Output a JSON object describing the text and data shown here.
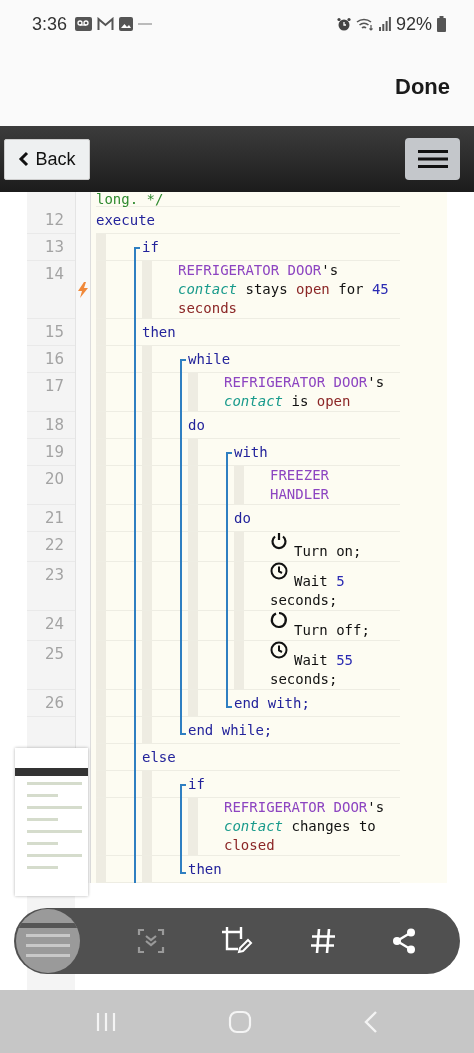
{
  "status_bar": {
    "time": "3:36",
    "battery": "92%"
  },
  "header": {
    "done": "Done"
  },
  "app_bar": {
    "back": "Back"
  },
  "code": [
    {
      "kind": "line",
      "flagged": false,
      "words": [
        [
          {
            "text": "long. */",
            "kind": "comment"
          }
        ]
      ]
    },
    {
      "kind": "line",
      "num": "12",
      "flagged": false,
      "words": [
        [
          {
            "text": "execute",
            "kind": "keyword"
          }
        ]
      ],
      "children": [
        {
          "kind": "block",
          "parts": [
            {
              "kind": "line",
              "num": "13",
              "flagged": false,
              "words": [
                [
                  {
                    "text": "if",
                    "kind": "keyword"
                  }
                ]
              ],
              "children": [
                {
                  "kind": "line",
                  "num": "14",
                  "flagged": true,
                  "words": [
                    [
                      {
                        "text": "REFRIGERATOR DOOR",
                        "kind": "device"
                      },
                      {
                        "text": "'s",
                        "kind": "plain"
                      }
                    ],
                    [
                      {
                        "text": "contact",
                        "kind": "attribute"
                      }
                    ],
                    [
                      {
                        "text": "stays",
                        "kind": "plain"
                      }
                    ],
                    [
                      {
                        "text": "open",
                        "kind": "state"
                      }
                    ],
                    [
                      {
                        "text": "for",
                        "kind": "plain"
                      }
                    ],
                    [
                      {
                        "text": "45",
                        "kind": "number"
                      }
                    ],
                    [
                      {
                        "text": "seconds",
                        "kind": "state"
                      }
                    ]
                  ]
                }
              ]
            },
            {
              "kind": "line",
              "num": "15",
              "flagged": false,
              "words": [
                [
                  {
                    "text": "then",
                    "kind": "keyword"
                  }
                ]
              ],
              "children": [
                {
                  "kind": "block",
                  "parts": [
                    {
                      "kind": "line",
                      "num": "16",
                      "flagged": false,
                      "words": [
                        [
                          {
                            "text": "while",
                            "kind": "keyword"
                          }
                        ]
                      ],
                      "children": [
                        {
                          "kind": "line",
                          "num": "17",
                          "flagged": false,
                          "words": [
                            [
                              {
                                "text": "REFRIGERATOR DOOR",
                                "kind": "device"
                              },
                              {
                                "text": "'s",
                                "kind": "plain"
                              }
                            ],
                            [
                              {
                                "text": "contact",
                                "kind": "attribute"
                              }
                            ],
                            [
                              {
                                "text": "is",
                                "kind": "plain"
                              }
                            ],
                            [
                              {
                                "text": "open",
                                "kind": "state"
                              }
                            ]
                          ]
                        }
                      ]
                    },
                    {
                      "kind": "line",
                      "num": "18",
                      "flagged": false,
                      "words": [
                        [
                          {
                            "text": "do",
                            "kind": "keyword"
                          }
                        ]
                      ],
                      "children": [
                        {
                          "kind": "block",
                          "parts": [
                            {
                              "kind": "line",
                              "num": "19",
                              "flagged": false,
                              "words": [
                                [
                                  {
                                    "text": "with",
                                    "kind": "keyword"
                                  }
                                ]
                              ],
                              "children": [
                                {
                                  "kind": "line",
                                  "num": "20",
                                  "flagged": false,
                                  "words": [
                                    [
                                      {
                                        "text": "FREEZER HANDLER",
                                        "kind": "device"
                                      }
                                    ]
                                  ]
                                }
                              ]
                            },
                            {
                              "kind": "line",
                              "num": "21",
                              "flagged": false,
                              "words": [
                                [
                                  {
                                    "text": "do",
                                    "kind": "keyword"
                                  }
                                ]
                              ],
                              "children": [
                                {
                                  "kind": "line",
                                  "num": "22",
                                  "flagged": false,
                                  "words": [
                                    [
                                      {
                                        "kind": "power_on"
                                      }
                                    ],
                                    [
                                      {
                                        "text": "Turn on;",
                                        "kind": "plain"
                                      }
                                    ]
                                  ]
                                },
                                {
                                  "kind": "line",
                                  "num": "23",
                                  "flagged": false,
                                  "words": [
                                    [
                                      {
                                        "kind": "wait"
                                      }
                                    ],
                                    [
                                      {
                                        "text": "Wait",
                                        "kind": "plain"
                                      }
                                    ],
                                    [
                                      {
                                        "text": "5",
                                        "kind": "number"
                                      }
                                    ],
                                    [
                                      {
                                        "text": "seconds;",
                                        "kind": "plain"
                                      }
                                    ]
                                  ]
                                },
                                {
                                  "kind": "line",
                                  "num": "24",
                                  "flagged": false,
                                  "words": [
                                    [
                                      {
                                        "kind": "power_off"
                                      }
                                    ],
                                    [
                                      {
                                        "text": "Turn off;",
                                        "kind": "plain"
                                      }
                                    ]
                                  ]
                                },
                                {
                                  "kind": "line",
                                  "num": "25",
                                  "flagged": false,
                                  "words": [
                                    [
                                      {
                                        "kind": "wait"
                                      }
                                    ],
                                    [
                                      {
                                        "text": "Wait",
                                        "kind": "plain"
                                      }
                                    ],
                                    [
                                      {
                                        "text": "55",
                                        "kind": "number"
                                      }
                                    ],
                                    [
                                      {
                                        "text": "seconds;",
                                        "kind": "plain"
                                      }
                                    ]
                                  ]
                                }
                              ]
                            },
                            {
                              "kind": "line",
                              "num": "26",
                              "flagged": false,
                              "words": [
                                [
                                  {
                                    "text": "end with;",
                                    "kind": "keyword"
                                  }
                                ]
                              ]
                            }
                          ]
                        }
                      ]
                    },
                    {
                      "kind": "line",
                      "flagged": false,
                      "words": [
                        [
                          {
                            "text": "end while;",
                            "kind": "keyword"
                          }
                        ]
                      ]
                    }
                  ]
                }
              ]
            },
            {
              "kind": "line",
              "flagged": false,
              "words": [
                [
                  {
                    "text": "else",
                    "kind": "keyword"
                  }
                ]
              ],
              "children": [
                {
                  "kind": "block",
                  "parts": [
                    {
                      "kind": "line",
                      "flagged": false,
                      "words": [
                        [
                          {
                            "text": "if",
                            "kind": "keyword"
                          }
                        ]
                      ],
                      "children": [
                        {
                          "kind": "line",
                          "flagged": false,
                          "words": [
                            [
                              {
                                "text": "REFRIGERATOR DOOR",
                                "kind": "device"
                              },
                              {
                                "text": "'s",
                                "kind": "plain"
                              }
                            ],
                            [
                              {
                                "text": "contact",
                                "kind": "attribute"
                              }
                            ],
                            [
                              {
                                "text": "changes",
                                "kind": "plain"
                              }
                            ],
                            [
                              {
                                "text": "to",
                                "kind": "plain"
                              }
                            ],
                            [
                              {
                                "text": "closed",
                                "kind": "state"
                              }
                            ]
                          ]
                        }
                      ]
                    },
                    {
                      "kind": "line",
                      "flagged": false,
                      "words": [
                        [
                          {
                            "text": "then",
                            "kind": "keyword"
                          }
                        ]
                      ]
                    }
                  ]
                }
              ]
            }
          ]
        }
      ]
    }
  ]
}
